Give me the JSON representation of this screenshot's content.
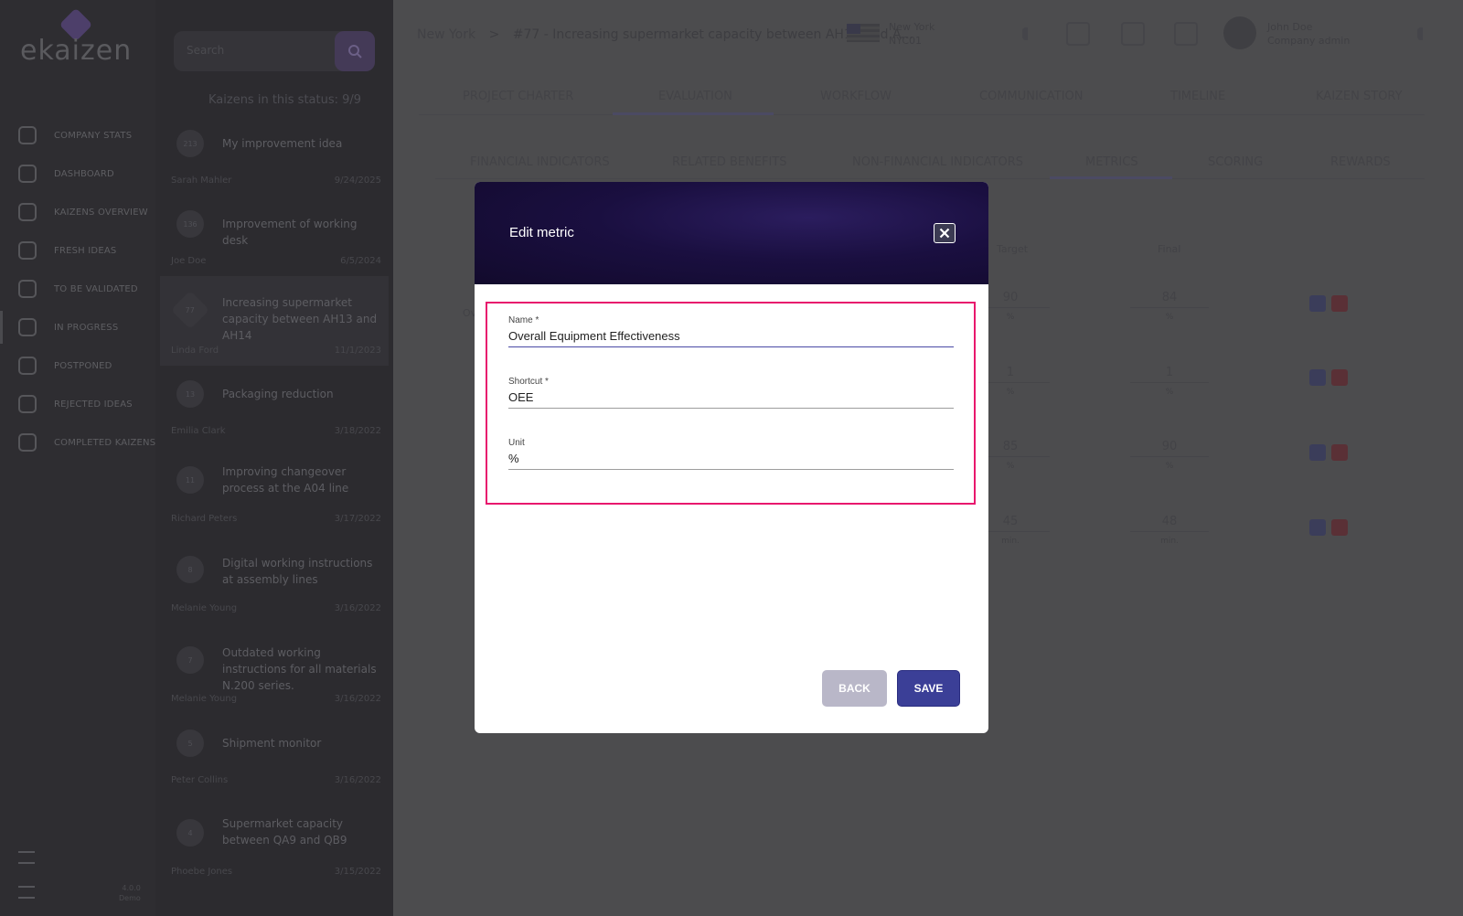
{
  "app": {
    "logo_text": "ekaizen",
    "version_text": [
      "4.0.0",
      "Demo"
    ]
  },
  "nav": {
    "items": [
      {
        "label": "COMPANY STATS",
        "icon": "globe-icon"
      },
      {
        "label": "DASHBOARD",
        "icon": "pie-chart-icon"
      },
      {
        "label": "KAIZENS OVERVIEW",
        "icon": "barcode-icon"
      },
      {
        "label": "FRESH IDEAS",
        "icon": "lightbulb-icon"
      },
      {
        "label": "TO BE VALIDATED",
        "icon": "scale-icon"
      },
      {
        "label": "IN PROGRESS",
        "icon": "clipboard-icon"
      },
      {
        "label": "POSTPONED",
        "icon": "pencil-clipboard-icon"
      },
      {
        "label": "REJECTED IDEAS",
        "icon": "clipboard-x-icon"
      },
      {
        "label": "COMPLETED KAIZENS",
        "icon": "rocket-icon"
      }
    ]
  },
  "search": {
    "placeholder": "Search"
  },
  "kaizen_list": {
    "count_label": "Kaizens in this status: 9/9",
    "items": [
      {
        "num": "213",
        "title": "My improvement idea",
        "author": "Sarah Mahler",
        "date": "9/24/2025"
      },
      {
        "num": "136",
        "title": "Improvement of working desk",
        "author": "Joe Doe",
        "date": "6/5/2024"
      },
      {
        "num": "77",
        "title": "Increasing supermarket capacity between AH13 and AH14",
        "author": "Linda Ford",
        "date": "11/1/2023"
      },
      {
        "num": "13",
        "title": "Packaging reduction",
        "author": "Emilia Clark",
        "date": "3/18/2022"
      },
      {
        "num": "11",
        "title": "Improving changeover process at the A04 line",
        "author": "Richard Peters",
        "date": "3/17/2022"
      },
      {
        "num": "8",
        "title": "Digital working instructions at assembly lines",
        "author": "Melanie Young",
        "date": "3/16/2022"
      },
      {
        "num": "7",
        "title": "Outdated working instructions for all materials N.200 series.",
        "author": "Melanie Young",
        "date": "3/16/2022"
      },
      {
        "num": "5",
        "title": "Shipment monitor",
        "author": "Peter Collins",
        "date": "3/16/2022"
      },
      {
        "num": "4",
        "title": "Supermarket capacity between QA9 and QB9",
        "author": "Phoebe Jones",
        "date": "3/15/2022"
      }
    ]
  },
  "header": {
    "breadcrumb_city": "New York",
    "breadcrumb_sep": ">",
    "breadcrumb_title": "#77 - Increasing supermarket capacity between AH13 and A...",
    "location_name": "New York",
    "location_code": "NYC01",
    "user_name": "John Doe",
    "user_role": "Company admin"
  },
  "tabs": [
    "PROJECT CHARTER",
    "EVALUATION",
    "WORKFLOW",
    "COMMUNICATION",
    "TIMELINE",
    "KAIZEN STORY"
  ],
  "subtabs": [
    "FINANCIAL INDICATORS",
    "RELATED BENEFITS",
    "NON-FINANCIAL INDICATORS",
    "METRICS",
    "SCORING",
    "REWARDS"
  ],
  "metrics_table": {
    "col_target": "Target",
    "col_final": "Final",
    "row_label_fragment": "Ov",
    "rows": [
      {
        "target": "90",
        "final": "84",
        "unit": "%"
      },
      {
        "target": "1",
        "final": "1",
        "unit": "%"
      },
      {
        "target": "85",
        "final": "90",
        "unit": "%"
      },
      {
        "target": "45",
        "final": "48",
        "unit": "min."
      }
    ]
  },
  "modal": {
    "title": "Edit metric",
    "name_label": "Name *",
    "name_value": "Overall Equipment Effectiveness",
    "shortcut_label": "Shortcut *",
    "shortcut_value": "OEE",
    "unit_label": "Unit",
    "unit_value": "%",
    "back_label": "BACK",
    "save_label": "SAVE"
  },
  "colors": {
    "modal_header": "#1a0f40",
    "highlight_border": "#e8186d",
    "save_button": "#3b3f97",
    "back_button": "#b9b7c8"
  }
}
